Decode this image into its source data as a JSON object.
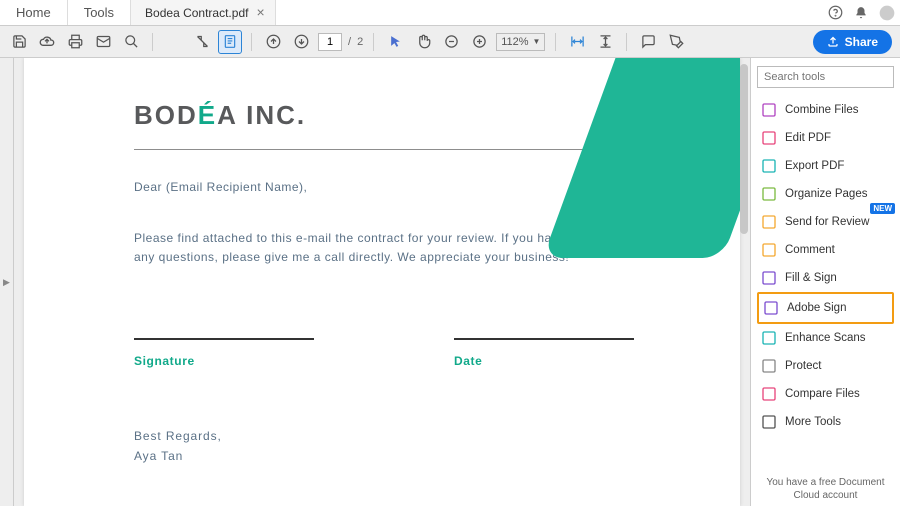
{
  "nav": {
    "home": "Home",
    "tools": "Tools"
  },
  "tab": {
    "title": "Bodea Contract.pdf"
  },
  "toolbar": {
    "page_current": "1",
    "page_total": "2",
    "page_sep": "/",
    "zoom": "112%",
    "share": "Share"
  },
  "doc": {
    "company_pre": "BOD",
    "company_accent": "É",
    "company_post": "A INC.",
    "greeting": "Dear (Email Recipient Name),",
    "p1l1": "Please find attached to this e-mail the contract for your review. If you have",
    "p1l2": "any questions, please give me a call directly. We appreciate your business!",
    "sig": "Signature",
    "date": "Date",
    "closing1": "Best Regards,",
    "closing2": "Aya Tan"
  },
  "panel": {
    "search_placeholder": "Search tools",
    "items": [
      {
        "label": "Combine Files",
        "color": "#b146c2"
      },
      {
        "label": "Edit PDF",
        "color": "#e8467c"
      },
      {
        "label": "Export PDF",
        "color": "#1cb5b5"
      },
      {
        "label": "Organize Pages",
        "color": "#7cbb42"
      },
      {
        "label": "Send for Review",
        "color": "#f4a933",
        "new": "NEW"
      },
      {
        "label": "Comment",
        "color": "#f4a933"
      },
      {
        "label": "Fill & Sign",
        "color": "#7d4fd0"
      },
      {
        "label": "Adobe Sign",
        "color": "#7d4fd0",
        "hl": true
      },
      {
        "label": "Enhance Scans",
        "color": "#1cb5b5"
      },
      {
        "label": "Protect",
        "color": "#888888"
      },
      {
        "label": "Compare Files",
        "color": "#e8467c"
      },
      {
        "label": "More Tools",
        "color": "#555555"
      }
    ],
    "footer1": "You have a free Document",
    "footer2": "Cloud account"
  }
}
